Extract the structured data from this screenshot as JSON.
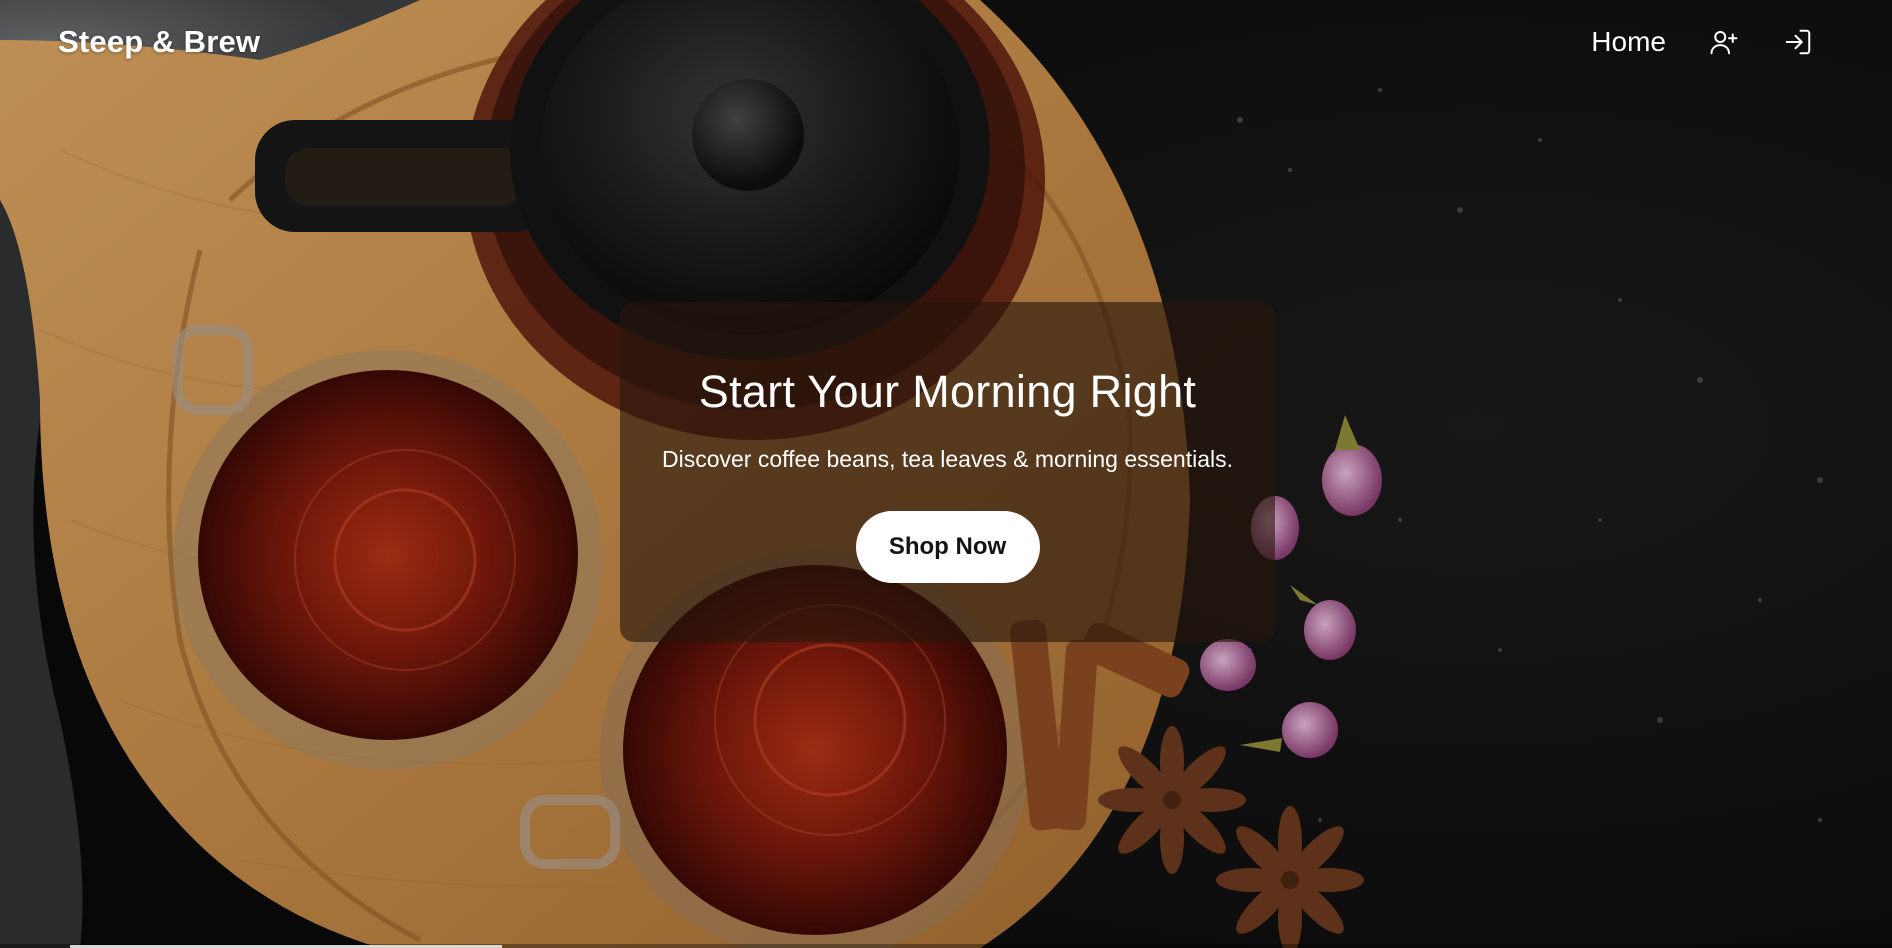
{
  "brand": {
    "name": "Steep & Brew"
  },
  "nav": {
    "home_label": "Home",
    "icons": [
      "user-plus-icon",
      "sign-in-icon"
    ]
  },
  "hero": {
    "title": "Start Your Morning Right",
    "subtitle": "Discover coffee beans, tea leaves & morning essentials.",
    "cta_label": "Shop Now"
  },
  "colors": {
    "card_overlay": "#26160c",
    "button_bg": "#ffffff",
    "button_text": "#141414",
    "text": "#ffffff",
    "board_wood": "#c8914f",
    "tea": "#7a1c0e",
    "slate": "#161616"
  }
}
